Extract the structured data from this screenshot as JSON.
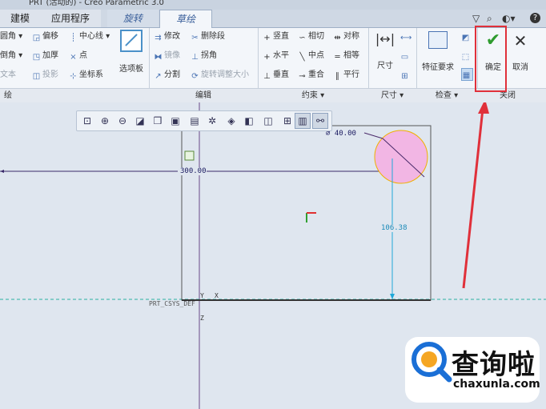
{
  "titlebar": {
    "text": "PRT (活动的) - Creo Parametric 3.0"
  },
  "tabs": [
    {
      "label": "建模"
    },
    {
      "label": "应用程序"
    },
    {
      "label": "旋转"
    },
    {
      "label": "草绘"
    }
  ],
  "window_controls": [
    "▽",
    "⌕",
    "◐▾",
    "?"
  ],
  "ribbon": {
    "sketch_col1": [
      "圆角",
      "倒角",
      "文本"
    ],
    "sketch_col2": [
      "偏移",
      "加厚",
      "投影"
    ],
    "sketch_col3": [
      "中心线",
      "点",
      "坐标系"
    ],
    "palette": "选项板",
    "edit": [
      "修改",
      "删除段",
      "镜像",
      "拐角",
      "分割",
      "旋转调整大小"
    ],
    "constraints": [
      "竖直",
      "相切",
      "对称",
      "水平",
      "中点",
      "相等",
      "垂直",
      "重合",
      "平行"
    ],
    "dimension": "尺寸",
    "inspect": "特征要求",
    "ok": "确定",
    "cancel": "取消"
  },
  "groups": [
    "绘",
    "编辑",
    "约束 ▾",
    "尺寸 ▾",
    "检查 ▾",
    "关闭"
  ],
  "canvas": {
    "dim_diameter": "⌀ 40.00",
    "dim_width": "300.00",
    "dim_height": "106.38",
    "csys_label": "PRT_CSYS_DEF",
    "axis_y": "Y",
    "axis_x": "X",
    "axis_z": "Z"
  },
  "watermark": {
    "big": "查询啦",
    "small": "chaxunla.com"
  },
  "colors": {
    "highlight": "#e0303a",
    "ok_check": "#2e9b2e",
    "circle_fill": "#f2b6e4",
    "dim_cyan": "#20a8d8"
  }
}
